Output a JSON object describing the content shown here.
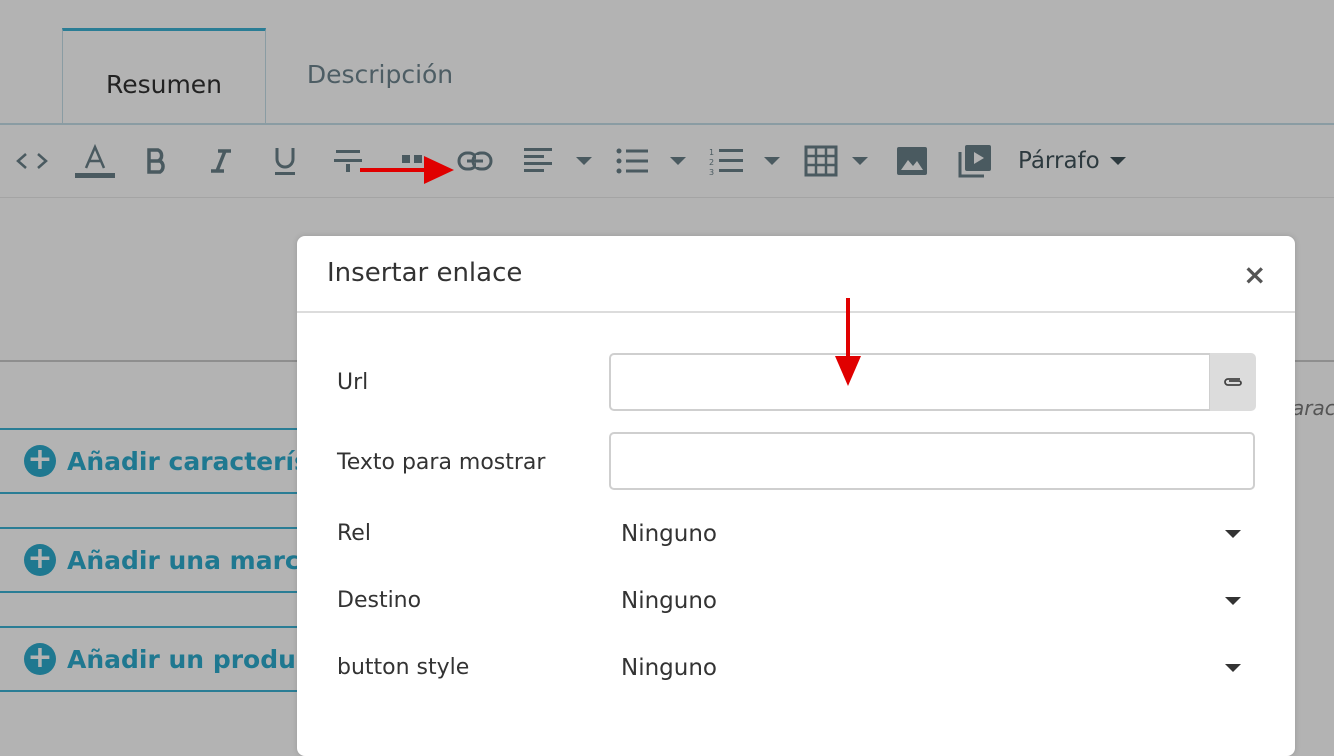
{
  "tabs": [
    {
      "label": "Resumen",
      "active": true
    },
    {
      "label": "Descripción",
      "active": false
    }
  ],
  "toolbar": {
    "icons": [
      "code-icon",
      "text-color-icon",
      "bold-icon",
      "italic-icon",
      "underline-icon",
      "strikethrough-icon",
      "blockquote-icon",
      "link-icon",
      "align-icon",
      "bullet-list-icon",
      "numbered-list-icon",
      "table-icon",
      "image-icon",
      "media-icon"
    ],
    "format_label": "Párrafo"
  },
  "features": [
    {
      "label": "Añadir característica"
    },
    {
      "label": "Añadir una marca"
    },
    {
      "label": "Añadir un producto"
    }
  ],
  "side_hint": "aract",
  "modal": {
    "title": "Insertar enlace",
    "close_symbol": "×",
    "url_label": "Url",
    "url_value": "",
    "display_text_label": "Texto para mostrar",
    "display_text_value": "",
    "rel_label": "Rel",
    "rel_value": "Ninguno",
    "target_label": "Destino",
    "target_value": "Ninguno",
    "button_style_label": "button style",
    "button_style_value": "Ninguno"
  },
  "colors": {
    "accent": "#1f7890",
    "backdrop": "#b3b3b3",
    "annotation_arrow": "#e00000"
  }
}
